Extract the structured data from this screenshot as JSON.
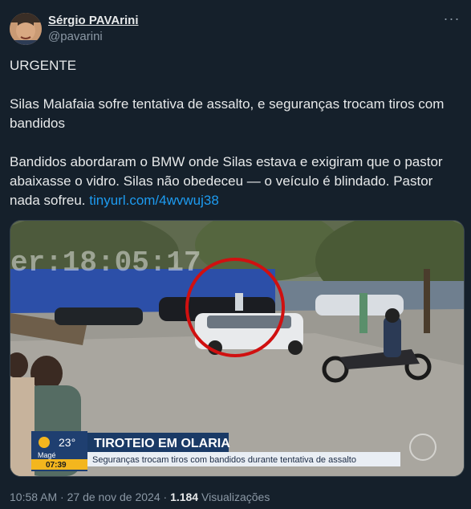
{
  "author": {
    "display_name": "Sérgio PAVArini",
    "handle": "@pavarini"
  },
  "more_label": "···",
  "tweet": {
    "p1": "URGENTE",
    "p2": "Silas Malafaia sofre tentativa de assalto, e seguranças trocam tiros com bandidos",
    "p3": "Bandidos abordaram o BMW onde Silas estava e exigiram que o pastor abaixasse o vidro. Silas não obedeceu — o veículo é blindado. Pastor nada sofreu. ",
    "link": "tinyurl.com/4wvwuj38"
  },
  "video": {
    "timestamp_overlay": "er:18:05:17",
    "temp": "23°",
    "city": "Magé",
    "time": "07:39",
    "headline": "TIROTEIO EM OLARIA",
    "subheadline": "Seguranças trocam tiros com bandidos durante tentativa de assalto"
  },
  "meta": {
    "time": "10:58 AM",
    "sep1": " · ",
    "date": "27 de nov de 2024",
    "sep2": " · ",
    "views": "1.184",
    "views_label": " Visualizações"
  },
  "colors": {
    "background": "#15202b",
    "link": "#1d9bf0",
    "muted": "#8b98a5",
    "highlight_circle": "#d01010",
    "headline_bg": "#1a3a66"
  }
}
